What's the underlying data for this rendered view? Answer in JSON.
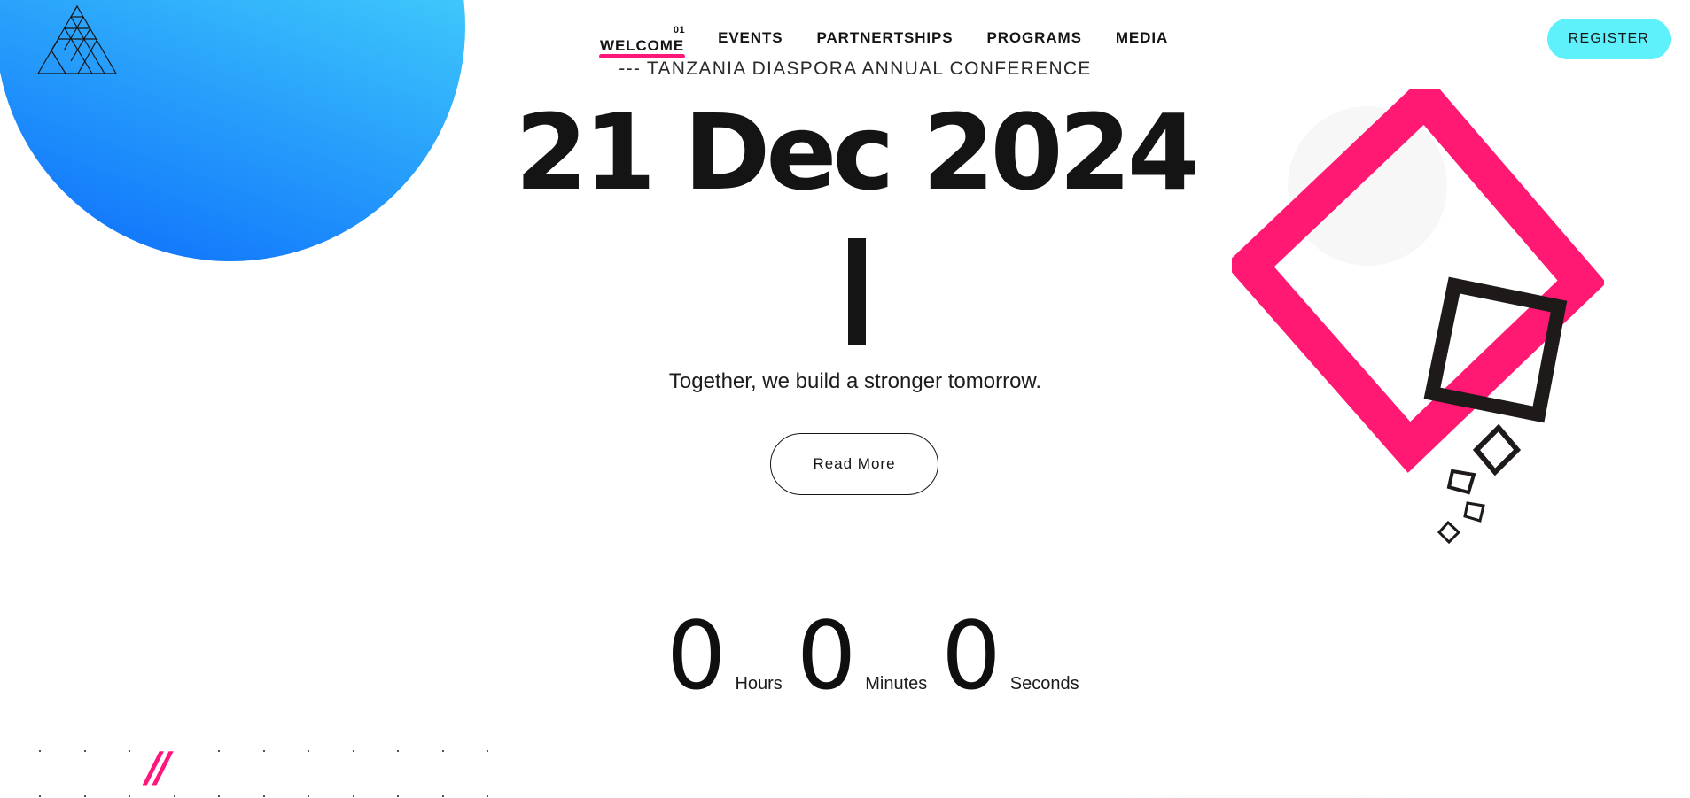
{
  "nav": {
    "items": [
      {
        "label": "WELCOME",
        "number": "01",
        "active": true
      },
      {
        "label": "EVENTS"
      },
      {
        "label": "PARTNERTSHIPS"
      },
      {
        "label": "PROGRAMS"
      },
      {
        "label": "MEDIA"
      }
    ],
    "register_label": "REGISTER"
  },
  "hero": {
    "subtitle": "--- TANZANIA DIASPORA ANNUAL CONFERENCE",
    "date": "21 Dec 2024",
    "tagline": "Together, we build a stronger tomorrow.",
    "read_more_label": "Read More"
  },
  "countdown": {
    "hours": {
      "value": "0",
      "label": "Hours"
    },
    "minutes": {
      "value": "0",
      "label": "Minutes"
    },
    "seconds": {
      "value": "0",
      "label": "Seconds"
    }
  },
  "decor": {
    "slashes": "//"
  },
  "colors": {
    "accent_pink": "#ff167a",
    "accent_cyan": "#5ef0fb",
    "gradient_blue": "#0b6bfb",
    "text_dark": "#141414"
  },
  "icons": {
    "logo": "triangle-lines-logo",
    "shapes": "geometric-squares-decoration"
  }
}
